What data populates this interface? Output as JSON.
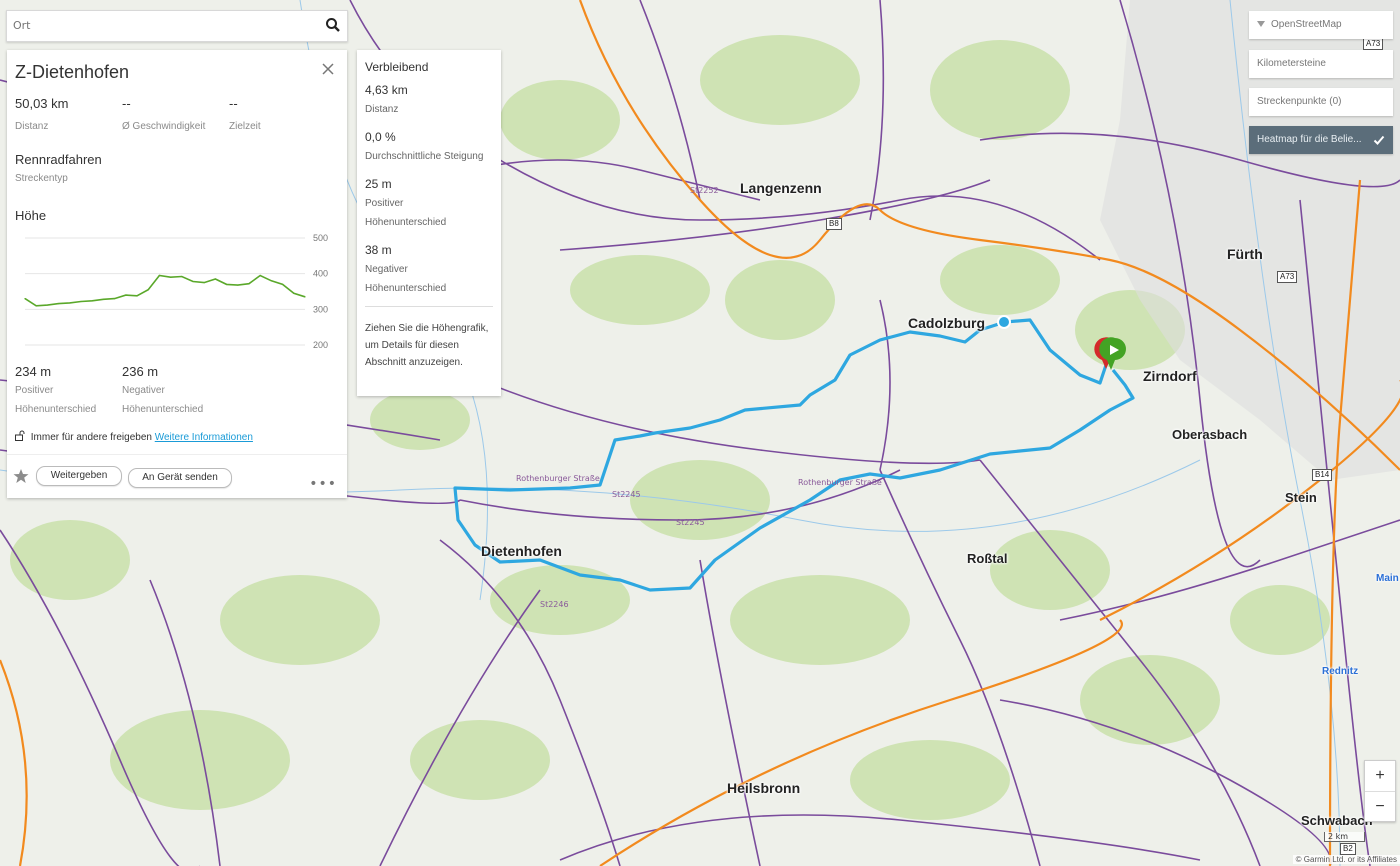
{
  "search": {
    "placeholder": "Ort"
  },
  "course": {
    "title": "Z-Dietenhofen",
    "distance": {
      "value": "50,03 km",
      "label": "Distanz"
    },
    "avg_speed": {
      "value": "--",
      "label": "Ø Geschwindigkeit"
    },
    "target_time": {
      "value": "--",
      "label": "Zielzeit"
    },
    "course_type": {
      "value": "Rennradfahren",
      "label": "Streckentyp"
    },
    "elevation_heading": "Höhe",
    "elevation_axis": [
      "500",
      "400",
      "300",
      "200"
    ],
    "ascent": {
      "value": "234 m",
      "label1": "Positiver",
      "label2": "Höhenunterschied"
    },
    "descent": {
      "value": "236 m",
      "label1": "Negativer",
      "label2": "Höhenunterschied"
    },
    "share_text": "Immer für andere freigeben",
    "share_link": "Weitere Informationen",
    "share_button": "Weitergeben",
    "send_button": "An Gerät senden",
    "more": "•••"
  },
  "remaining": {
    "heading": "Verbleibend",
    "distance": {
      "value": "4,63 km",
      "label": "Distanz"
    },
    "grade": {
      "value": "0,0 %",
      "label": "Durchschnittliche Steigung"
    },
    "ascent": {
      "value": "25 m",
      "label1": "Positiver",
      "label2": "Höhenunterschied"
    },
    "descent": {
      "value": "38 m",
      "label1": "Negativer",
      "label2": "Höhenunterschied"
    },
    "hint": "Ziehen Sie die Höhengrafik, um Details für diesen Abschnitt anzuzeigen."
  },
  "layers": {
    "basemap": "OpenStreetMap",
    "km_markers": "Kilometersteine",
    "course_points": "Streckenpunkte (0)",
    "heatmap": "Heatmap für die Belie..."
  },
  "map": {
    "places": {
      "langenzenn": "Langenzenn",
      "cadolzburg": "Cadolzburg",
      "zirndorf": "Zirndorf",
      "oberasbach": "Oberasbach",
      "fuerth": "Fürth",
      "stein": "Stein",
      "dietenhofen": "Dietenhofen",
      "rosstal": "Roßtal",
      "heilsbronn": "Heilsbronn",
      "schwabach": "Schwabach",
      "main": "Main",
      "rednitz": "Rednitz"
    },
    "shields": {
      "b8": "B8",
      "a73": "A73",
      "a73b": "A73",
      "b14": "B14",
      "b2": "B2"
    },
    "roads": {
      "st2245a": "St2245",
      "st2245b": "St2245",
      "st2246": "St2246",
      "st2252": "St2252",
      "rothenburger": "Rothenburger Straße",
      "rothenburger2": "Rothenburger Straße"
    },
    "scale": "2 km",
    "attribution": "© Garmin Ltd. or its Affiliates",
    "zoom_in": "+",
    "zoom_out": "−"
  },
  "colors": {
    "route": "#2ea7e0",
    "map_bg": "#eef0ea",
    "forest": "#cfe3b4",
    "road_purple": "#7a4b9c",
    "road_orange": "#f28a1e",
    "elevation_line": "#5aa82a"
  },
  "chart_data": {
    "type": "line",
    "ylabel": "",
    "ylim": [
      200,
      500
    ],
    "ticks": [
      500,
      400,
      300,
      200
    ],
    "series": [
      {
        "x": [
          0,
          2,
          4,
          6,
          8,
          10,
          12,
          14,
          16,
          18,
          20,
          22,
          24,
          26,
          28,
          30,
          32,
          34,
          36,
          38,
          40,
          42,
          44,
          46,
          48,
          50
        ],
        "values": [
          330,
          310,
          312,
          316,
          318,
          322,
          324,
          328,
          330,
          340,
          338,
          355,
          395,
          390,
          392,
          378,
          375,
          385,
          370,
          368,
          372,
          395,
          380,
          370,
          345,
          335
        ]
      }
    ]
  }
}
